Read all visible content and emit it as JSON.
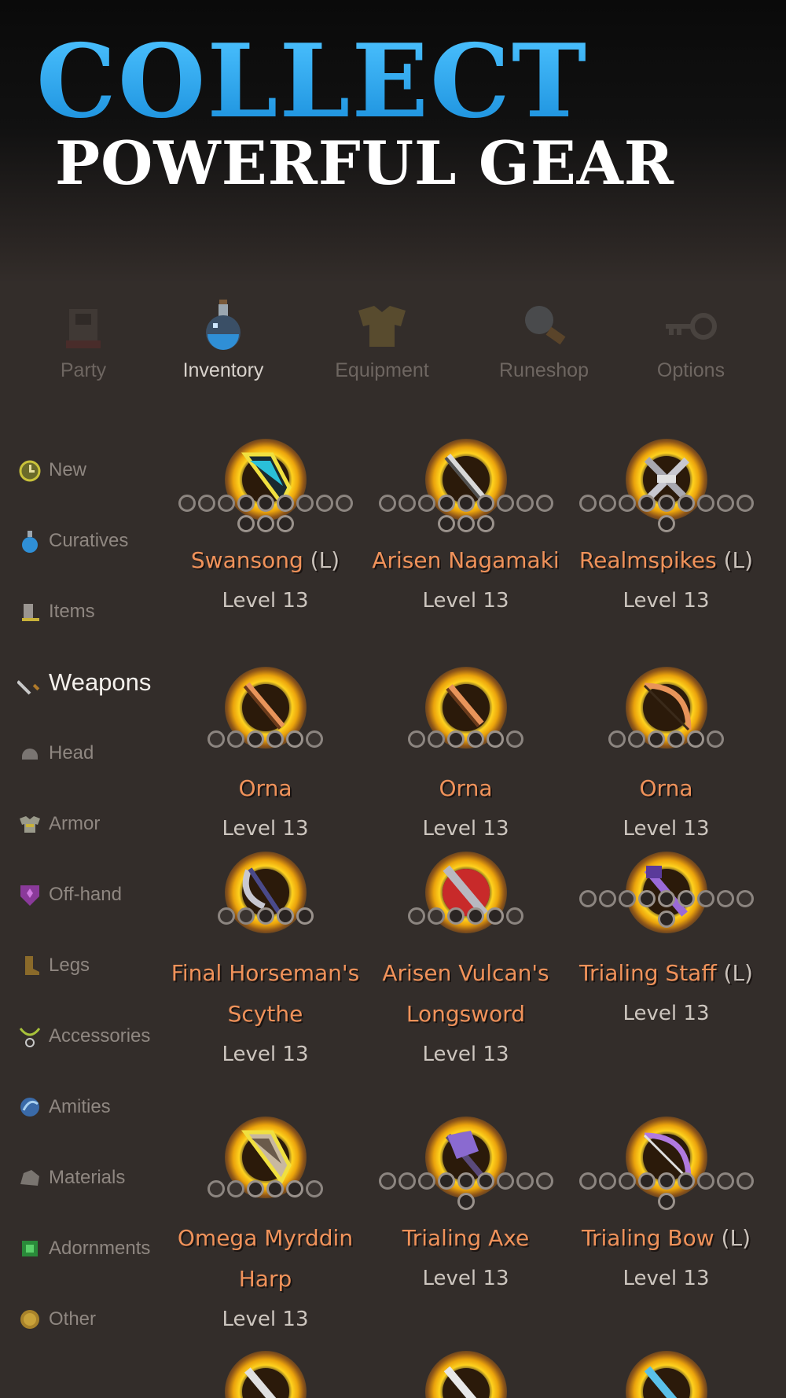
{
  "banner": {
    "line1": "COLLECT",
    "line2": "POWERFUL GEAR"
  },
  "topnav": {
    "tabs": [
      {
        "label": "Party",
        "icon": "party-icon",
        "active": false
      },
      {
        "label": "Inventory",
        "icon": "potion-icon",
        "active": true
      },
      {
        "label": "Equipment",
        "icon": "armor-icon",
        "active": false
      },
      {
        "label": "Runeshop",
        "icon": "runeshop-icon",
        "active": false
      },
      {
        "label": "Options",
        "icon": "key-icon",
        "active": false
      }
    ]
  },
  "sidebar": {
    "items": [
      {
        "label": "New",
        "icon": "clock-icon"
      },
      {
        "label": "Curatives",
        "icon": "potion-icon"
      },
      {
        "label": "Items",
        "icon": "item-icon"
      },
      {
        "label": "Weapons",
        "icon": "sword-icon",
        "active": true
      },
      {
        "label": "Head",
        "icon": "helmet-icon"
      },
      {
        "label": "Armor",
        "icon": "armor-icon"
      },
      {
        "label": "Off-hand",
        "icon": "shield-icon"
      },
      {
        "label": "Legs",
        "icon": "boots-icon"
      },
      {
        "label": "Accessories",
        "icon": "necklace-icon"
      },
      {
        "label": "Amities",
        "icon": "amity-icon"
      },
      {
        "label": "Materials",
        "icon": "rock-icon"
      },
      {
        "label": "Adornments",
        "icon": "gem-icon"
      },
      {
        "label": "Other",
        "icon": "coin-icon"
      }
    ]
  },
  "items": [
    {
      "name": "Swansong",
      "tag": "(L)",
      "level": "Level 13"
    },
    {
      "name": "Arisen Nagamaki",
      "tag": "",
      "level": "Level 13"
    },
    {
      "name": "Realmspikes",
      "tag": "(L)",
      "level": "Level 13"
    },
    {
      "name": "Orna",
      "tag": "",
      "level": "Level 13"
    },
    {
      "name": "Orna",
      "tag": "",
      "level": "Level 13"
    },
    {
      "name": "Orna",
      "tag": "",
      "level": "Level 13"
    },
    {
      "name": "Final Horseman's Scythe",
      "tag": "",
      "level": "Level 13"
    },
    {
      "name": "Arisen Vulcan's Longsword",
      "tag": "",
      "level": "Level 13"
    },
    {
      "name": "Trialing Staff",
      "tag": "(L)",
      "level": "Level 13"
    },
    {
      "name": "Omega Myrddin Harp",
      "tag": "",
      "level": "Level 13"
    },
    {
      "name": "Trialing Axe",
      "tag": "",
      "level": "Level 13"
    },
    {
      "name": "Trialing Bow",
      "tag": "(L)",
      "level": "Level 13"
    }
  ]
}
